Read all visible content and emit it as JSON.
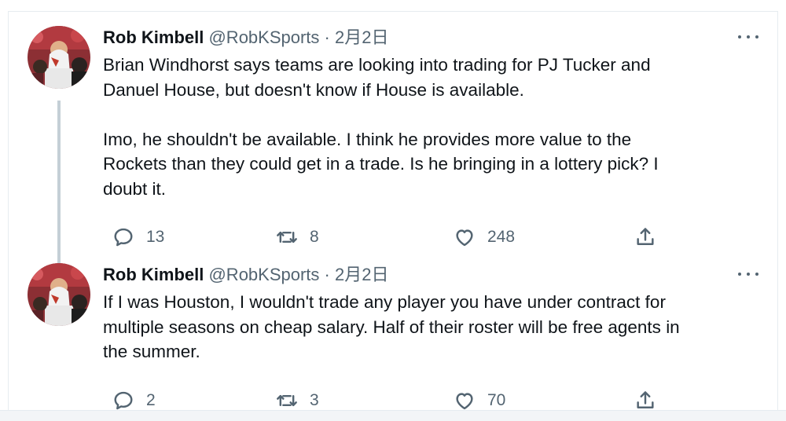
{
  "tweets": [
    {
      "name": "Rob Kimbell",
      "handle": "@RobKSports",
      "separator": "·",
      "date": "2月2日",
      "paragraphs": [
        "Brian Windhorst says teams are looking into trading for PJ Tucker and\nDanuel House, but doesn't know if House is available.",
        "Imo, he shouldn't be available. I think he provides more value to the\nRockets than they could get in a trade. Is he bringing in a lottery pick? I\ndoubt it."
      ],
      "replies": "13",
      "retweets": "8",
      "likes": "248"
    },
    {
      "name": "Rob Kimbell",
      "handle": "@RobKSports",
      "separator": "·",
      "date": "2月2日",
      "paragraphs": [
        "If I was Houston, I wouldn't trade any player you have under contract for\nmultiple seasons on cheap salary. Half of their roster will be free agents in\nthe summer."
      ],
      "replies": "2",
      "retweets": "3",
      "likes": "70"
    }
  ],
  "icons": {
    "reply": "speech-bubble-icon",
    "retweet": "retweet-arrows-icon",
    "like": "heart-icon",
    "share": "share-upload-icon",
    "more": "more-dots-icon"
  },
  "colors": {
    "text": "#0f1419",
    "secondary": "#536471",
    "thread_line": "#c4cfd6",
    "border": "#e6ecf0"
  }
}
